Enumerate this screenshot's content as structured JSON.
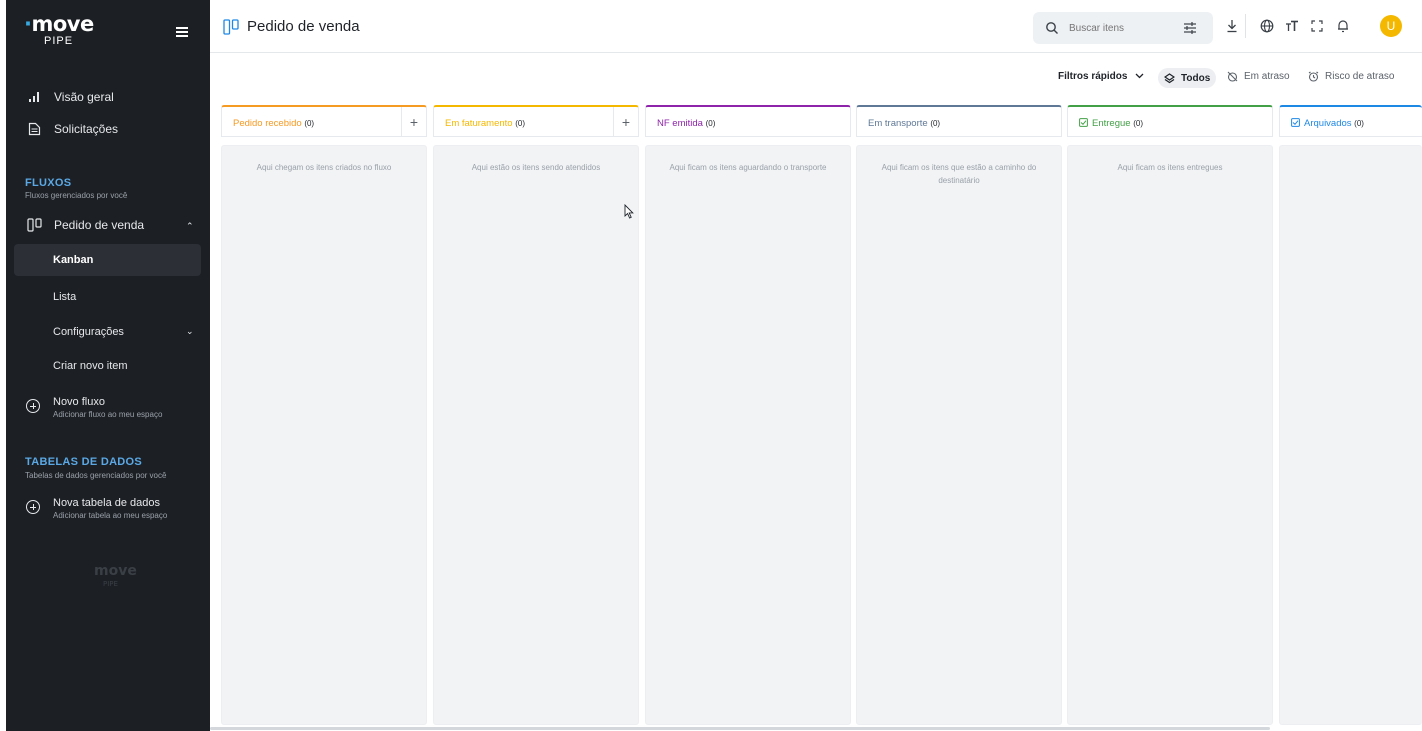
{
  "brand": {
    "logo": "move",
    "logo_sub": "PIPE"
  },
  "sidebar": {
    "items": [
      {
        "label": "Visão geral",
        "icon": "bar-chart-icon"
      },
      {
        "label": "Solicitações",
        "icon": "document-icon"
      }
    ],
    "flows_section": {
      "title": "FLUXOS",
      "subtitle": "Fluxos gerenciados por você"
    },
    "flow": {
      "label": "Pedido de venda",
      "sub_items": [
        "Kanban",
        "Lista",
        "Configurações",
        "Criar novo item"
      ],
      "active": "Kanban"
    },
    "new_flow": {
      "title": "Novo fluxo",
      "subtitle": "Adicionar fluxo ao meu espaço"
    },
    "tables_section": {
      "title": "TABELAS DE DADOS",
      "subtitle": "Tabelas de dados gerenciados por você"
    },
    "new_table": {
      "title": "Nova tabela de dados",
      "subtitle": "Adicionar tabela ao meu espaço"
    },
    "watermark": {
      "logo": "move",
      "sub": "PIPE"
    }
  },
  "header": {
    "title": "Pedido de venda",
    "search_placeholder": "Buscar itens",
    "avatar_initial": "U"
  },
  "filters": {
    "label": "Filtros rápidos",
    "options": [
      "Todos",
      "Em atraso",
      "Risco de atraso"
    ],
    "selected": "Todos"
  },
  "columns": [
    {
      "title": "Pedido recebido",
      "count": "(0)",
      "color": "#f59a23",
      "empty": "Aqui chegam os itens criados no fluxo",
      "addable": true
    },
    {
      "title": "Em faturamento",
      "count": "(0)",
      "color": "#f5b800",
      "empty": "Aqui estão os itens sendo atendidos",
      "addable": true
    },
    {
      "title": "NF emitida",
      "count": "(0)",
      "color": "#8e24aa",
      "empty": "Aqui ficam os itens aguardando o transporte",
      "addable": false
    },
    {
      "title": "Em transporte",
      "count": "(0)",
      "color": "#5f7896",
      "empty": "Aqui ficam os itens que estão a caminho do destinatário",
      "addable": false
    },
    {
      "title": "Entregue",
      "count": "(0)",
      "color": "#43a047",
      "empty": "Aqui ficam os itens entregues",
      "addable": false
    },
    {
      "title": "Arquivados",
      "count": "(0)",
      "color": "#1e88e5",
      "empty": "",
      "addable": false
    }
  ]
}
